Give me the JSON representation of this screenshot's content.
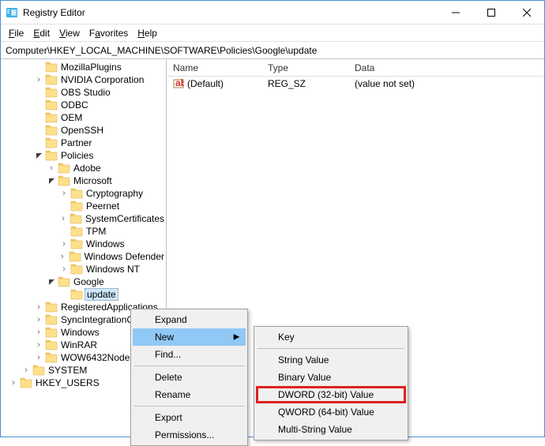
{
  "window": {
    "title": "Registry Editor"
  },
  "menu": {
    "file": "File",
    "edit": "Edit",
    "view": "View",
    "favorites": "Favorites",
    "help": "Help"
  },
  "address": "Computer\\HKEY_LOCAL_MACHINE\\SOFTWARE\\Policies\\Google\\update",
  "list": {
    "cols": {
      "name": "Name",
      "type": "Type",
      "data": "Data"
    },
    "rows": [
      {
        "name": "(Default)",
        "type": "REG_SZ",
        "data": "(value not set)"
      }
    ]
  },
  "tree": [
    {
      "indent": 42,
      "expander": "",
      "label": "MozillaPlugins"
    },
    {
      "indent": 42,
      "expander": ">",
      "label": "NVIDIA Corporation"
    },
    {
      "indent": 42,
      "expander": "",
      "label": "OBS Studio"
    },
    {
      "indent": 42,
      "expander": "",
      "label": "ODBC"
    },
    {
      "indent": 42,
      "expander": "",
      "label": "OEM"
    },
    {
      "indent": 42,
      "expander": "",
      "label": "OpenSSH"
    },
    {
      "indent": 42,
      "expander": "",
      "label": "Partner"
    },
    {
      "indent": 42,
      "expander": "v",
      "label": "Policies"
    },
    {
      "indent": 58,
      "expander": ">",
      "label": "Adobe"
    },
    {
      "indent": 58,
      "expander": "v",
      "label": "Microsoft"
    },
    {
      "indent": 74,
      "expander": ">",
      "label": "Cryptography"
    },
    {
      "indent": 74,
      "expander": "",
      "label": "Peernet"
    },
    {
      "indent": 74,
      "expander": ">",
      "label": "SystemCertificates"
    },
    {
      "indent": 74,
      "expander": "",
      "label": "TPM"
    },
    {
      "indent": 74,
      "expander": ">",
      "label": "Windows"
    },
    {
      "indent": 74,
      "expander": ">",
      "label": "Windows Defender"
    },
    {
      "indent": 74,
      "expander": ">",
      "label": "Windows NT"
    },
    {
      "indent": 58,
      "expander": "v",
      "label": "Google"
    },
    {
      "indent": 74,
      "expander": "",
      "label": "update",
      "selected": true
    },
    {
      "indent": 42,
      "expander": ">",
      "label": "RegisteredApplications"
    },
    {
      "indent": 42,
      "expander": ">",
      "label": "SyncIntegrationClients"
    },
    {
      "indent": 42,
      "expander": ">",
      "label": "Windows"
    },
    {
      "indent": 42,
      "expander": ">",
      "label": "WinRAR"
    },
    {
      "indent": 42,
      "expander": ">",
      "label": "WOW6432Node"
    },
    {
      "indent": 26,
      "expander": ">",
      "label": "SYSTEM"
    },
    {
      "indent": 10,
      "expander": ">",
      "label": "HKEY_USERS"
    }
  ],
  "context": {
    "expand": "Expand",
    "new": "New",
    "find": "Find...",
    "delete": "Delete",
    "rename": "Rename",
    "export": "Export",
    "permissions": "Permissions..."
  },
  "submenu": {
    "key": "Key",
    "string": "String Value",
    "binary": "Binary Value",
    "dword": "DWORD (32-bit) Value",
    "qword": "QWORD (64-bit) Value",
    "multistring": "Multi-String Value"
  }
}
